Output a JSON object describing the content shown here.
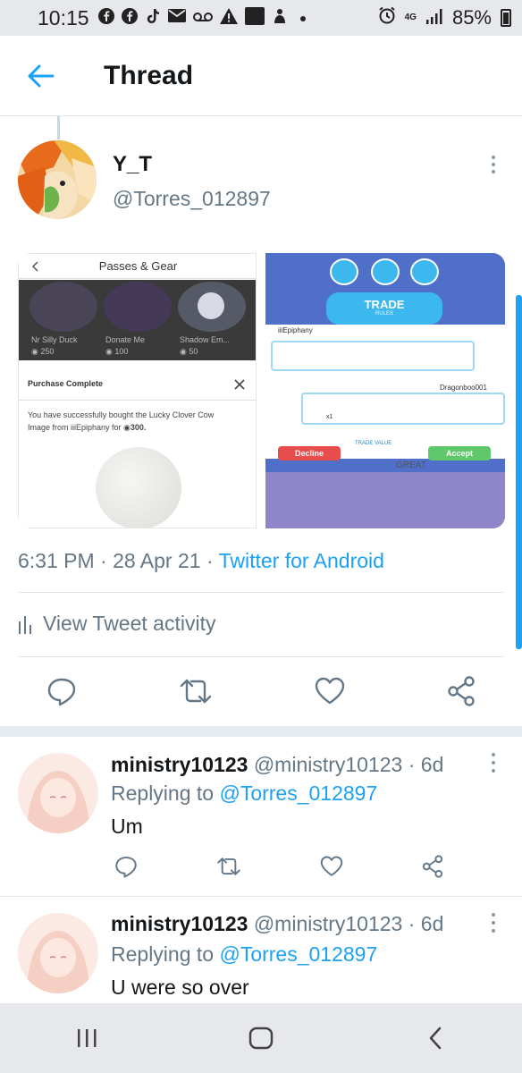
{
  "status_bar": {
    "time": "10:15",
    "battery": "85%",
    "notification_icons": [
      "facebook-icon",
      "facebook-icon",
      "tiktok-icon",
      "mail-icon",
      "voicemail-icon",
      "warning-icon",
      "webtoon-icon",
      "app-icon",
      "dot-icon"
    ],
    "webtoon_label": "WEB TOON",
    "network_label": "4G"
  },
  "header": {
    "title": "Thread"
  },
  "tweet": {
    "display_name": "Y_T",
    "handle": "@Torres_012897",
    "timestamp": "6:31 PM · 28 Apr 21 · ",
    "source": "Twitter for Android",
    "activity_label": "View Tweet activity",
    "media_left": {
      "title": "Passes & Gear",
      "items": [
        {
          "name": "Nr Silly Duck",
          "price": "250"
        },
        {
          "name": "Donate Me",
          "price": "100"
        },
        {
          "name": "Shadow Em...",
          "price": "50"
        }
      ],
      "modal_title": "Purchase Complete",
      "modal_text_1": "You have successfully bought the Lucky Clover Cow",
      "modal_text_2": "Image from iiiEpiphany for",
      "modal_price": "300."
    },
    "media_right": {
      "banner_title": "TRADE",
      "banner_sub": "RULES",
      "user_top": "iiiEpiphany",
      "user_bottom": "Dragonboo001",
      "decline_label": "Decline",
      "accept_label": "Accept",
      "trade_value_label": "TRADE VALUE",
      "trade_value": "GREAT",
      "item_count": "x1"
    }
  },
  "replies": [
    {
      "name": "ministry10123",
      "handle_time": " @ministry10123 · 6d",
      "replying_prefix": "Replying to ",
      "replying_to": "@Torres_012897",
      "text": "Um"
    },
    {
      "name": "ministry10123",
      "handle_time": " @ministry10123 · 6d",
      "replying_prefix": "Replying to ",
      "replying_to": "@Torres_012897",
      "text": "U were so over"
    }
  ],
  "colors": {
    "accent": "#1da1f2",
    "secondary_text": "#657786",
    "divider": "#e1e8ed"
  }
}
